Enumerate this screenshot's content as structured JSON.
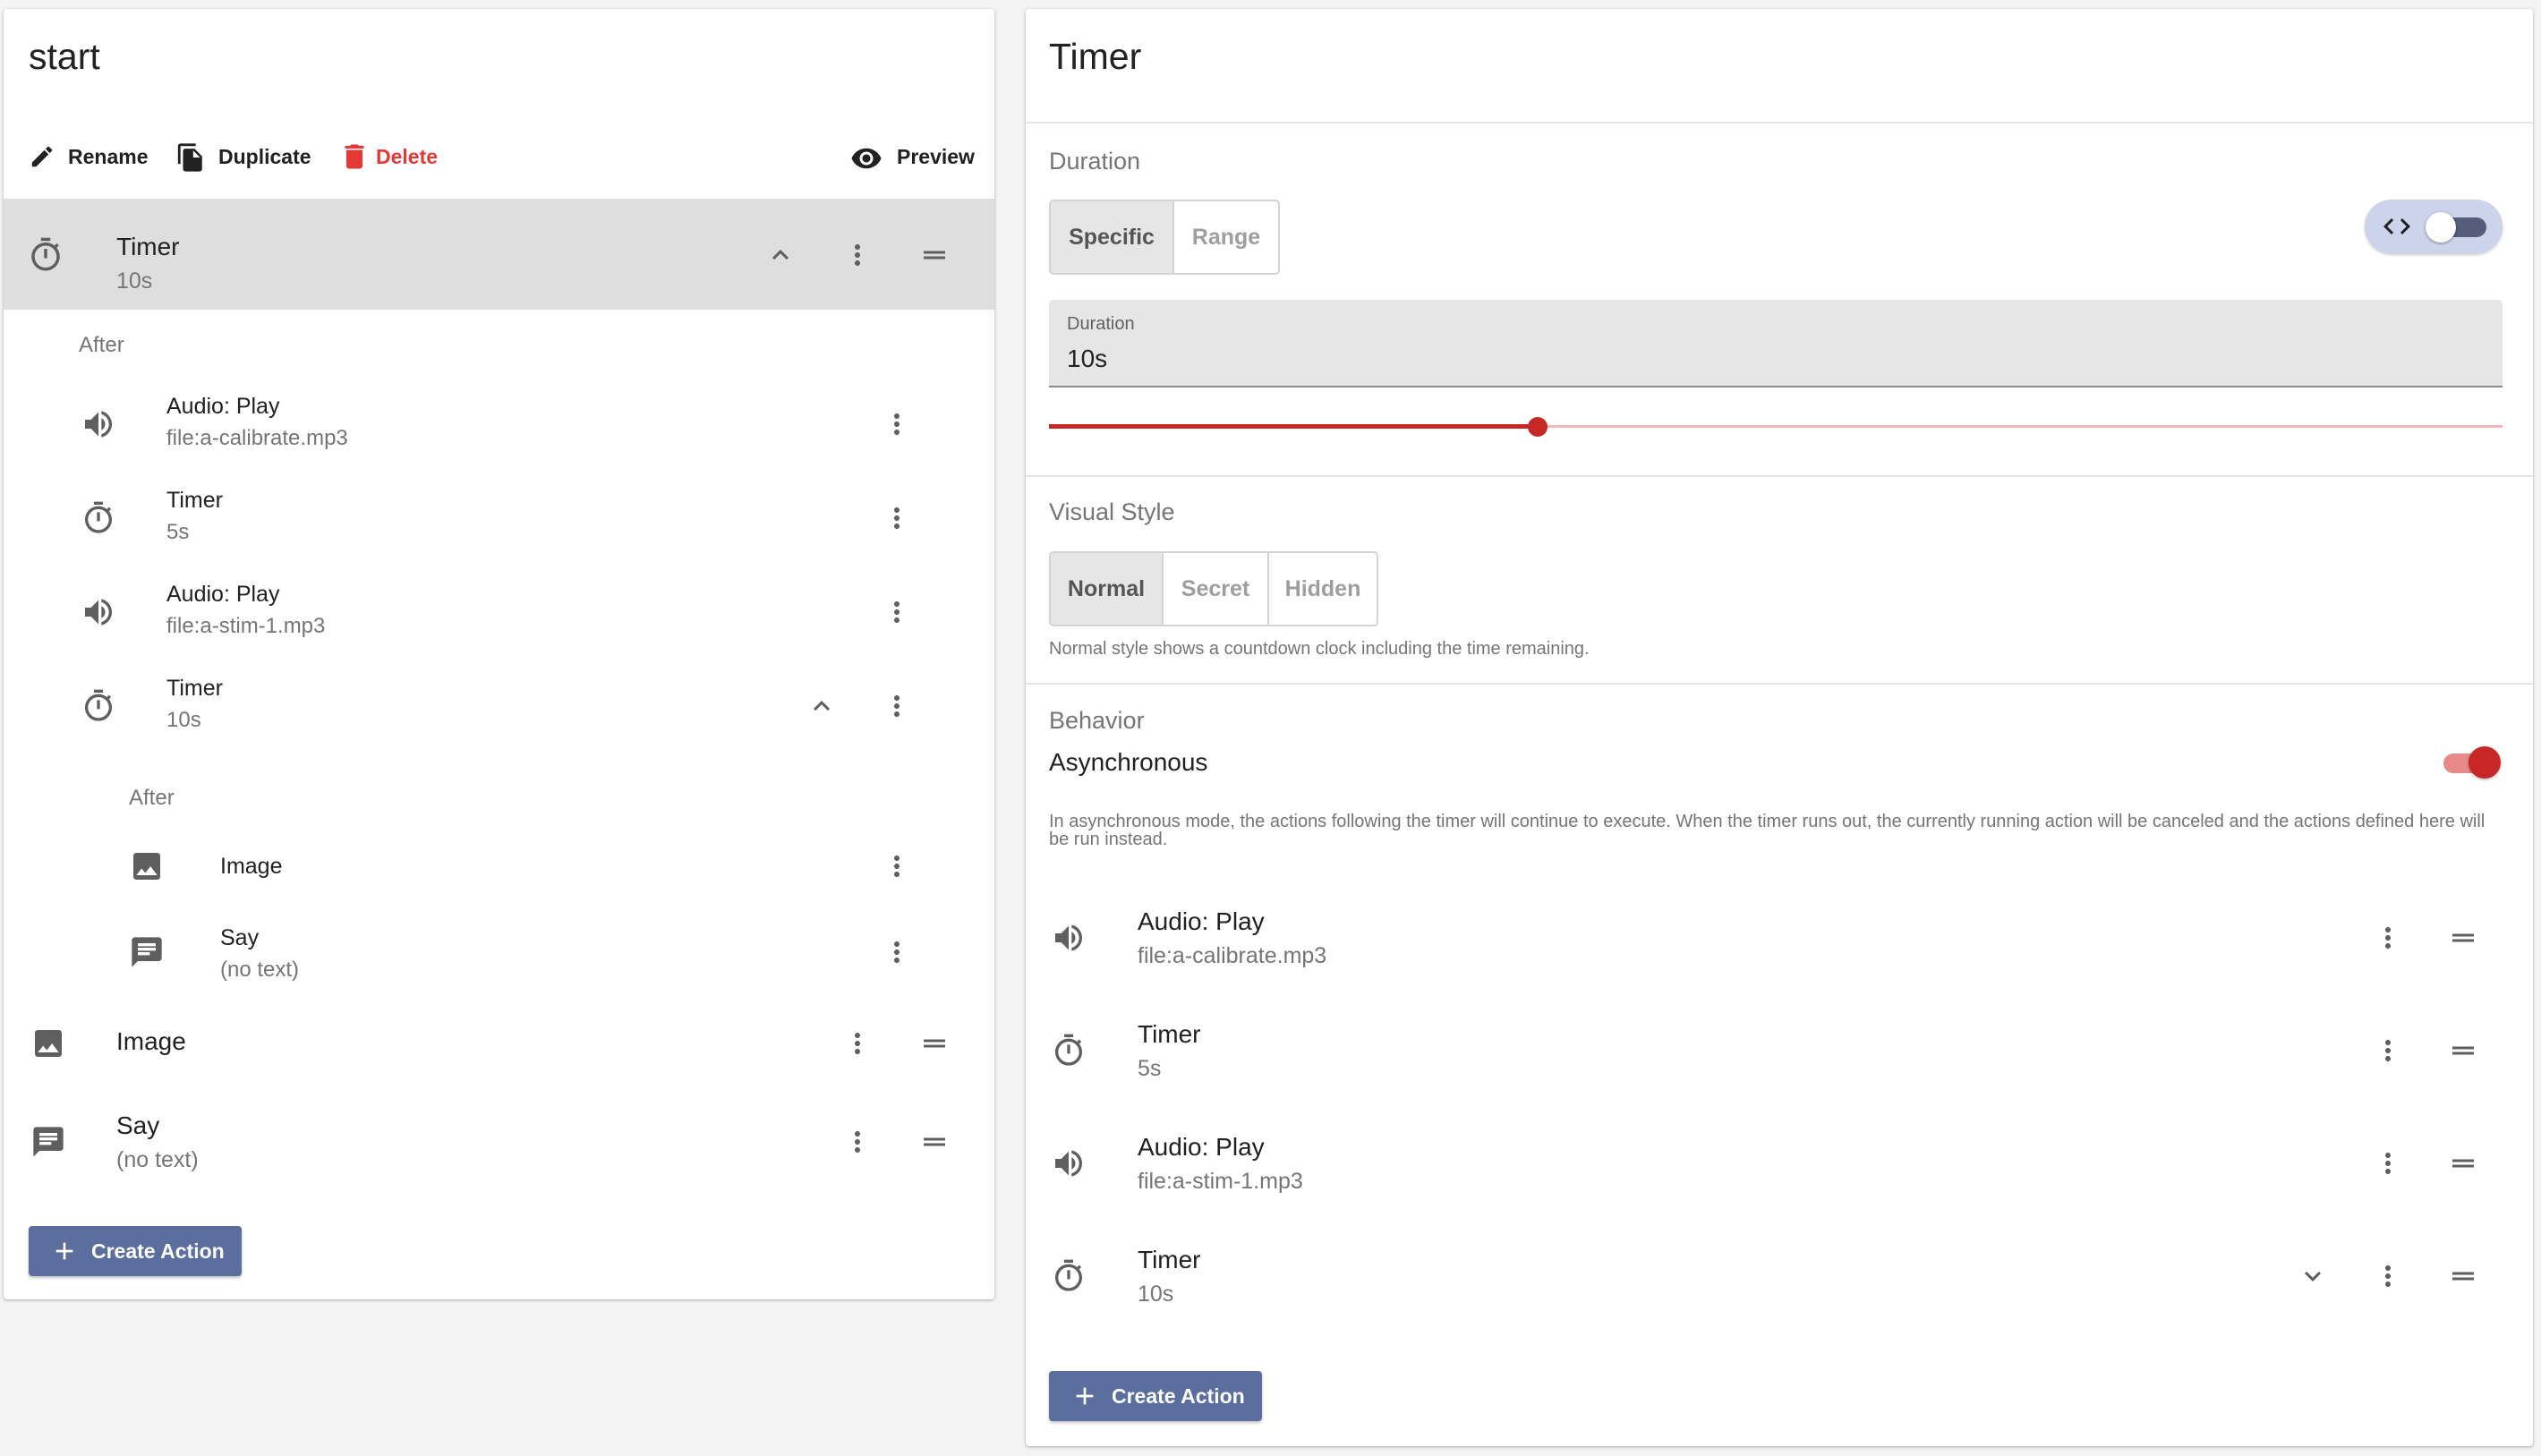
{
  "left": {
    "title": "start",
    "toolbar": {
      "rename": "Rename",
      "duplicate": "Duplicate",
      "delete": "Delete",
      "preview": "Preview"
    },
    "selected": {
      "label": "Timer",
      "sub": "10s"
    },
    "after1": "After",
    "children": [
      {
        "label": "Audio: Play",
        "sub": "file:a-calibrate.mp3",
        "icon": "volume-icon"
      },
      {
        "label": "Timer",
        "sub": "5s",
        "icon": "timer-icon"
      },
      {
        "label": "Audio: Play",
        "sub": "file:a-stim-1.mp3",
        "icon": "volume-icon"
      },
      {
        "label": "Timer",
        "sub": "10s",
        "icon": "timer-icon"
      }
    ],
    "after2": "After",
    "grandchildren": [
      {
        "label": "Image",
        "icon": "image-icon"
      },
      {
        "label": "Say",
        "sub": "(no text)",
        "icon": "message-icon"
      }
    ],
    "root_items": [
      {
        "label": "Image",
        "icon": "image-icon"
      },
      {
        "label": "Say",
        "sub": "(no text)",
        "icon": "message-icon"
      }
    ],
    "create": "Create Action"
  },
  "right": {
    "title": "Timer",
    "duration": {
      "heading": "Duration",
      "modes": [
        "Specific",
        "Range"
      ],
      "selected_mode": "Specific",
      "field_label": "Duration",
      "field_value": "10s",
      "slider_fraction": 0.336,
      "code_toggle_on": false
    },
    "visual": {
      "heading": "Visual Style",
      "options": [
        "Normal",
        "Secret",
        "Hidden"
      ],
      "selected": "Normal",
      "note": "Normal style shows a countdown clock including the time remaining."
    },
    "behavior": {
      "heading": "Behavior",
      "toggle_label": "Asynchronous",
      "toggle_on": true,
      "note": "In asynchronous mode, the actions following the timer will continue to execute. When the timer runs out, the currently running action will be canceled and the actions defined here will be run instead."
    },
    "actions": [
      {
        "label": "Audio: Play",
        "sub": "file:a-calibrate.mp3",
        "icon": "volume-icon"
      },
      {
        "label": "Timer",
        "sub": "5s",
        "icon": "timer-icon"
      },
      {
        "label": "Audio: Play",
        "sub": "file:a-stim-1.mp3",
        "icon": "volume-icon"
      },
      {
        "label": "Timer",
        "sub": "10s",
        "icon": "timer-icon"
      }
    ],
    "create": "Create Action"
  },
  "colors": {
    "accent": "#c62828",
    "button": "#5c6e9e",
    "selected_bg": "#dedede",
    "delete": "#e53935"
  }
}
